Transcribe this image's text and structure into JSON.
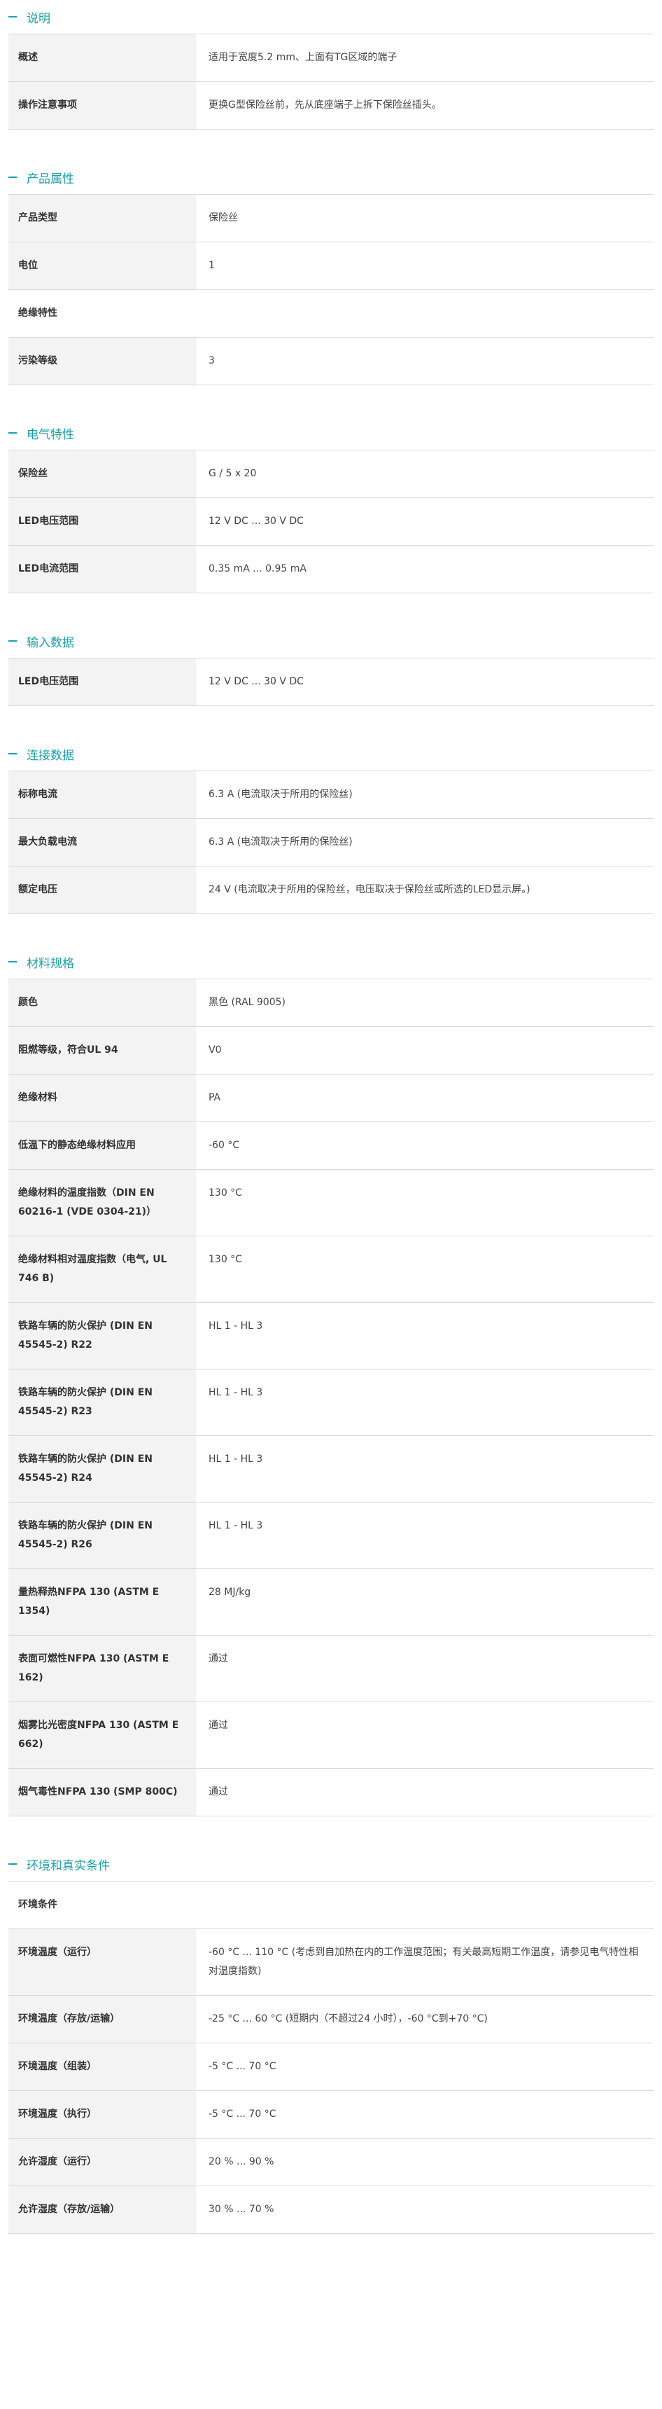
{
  "sections": {
    "s1": {
      "title": "说明",
      "rows": [
        {
          "k": "概述",
          "v": "适用于宽度5.2 mm、上面有TG区域的端子"
        },
        {
          "k": "操作注意事项",
          "v": "更换G型保险丝前，先从底座端子上拆下保险丝插头。"
        }
      ]
    },
    "s2": {
      "title": "产品属性",
      "rows": [
        {
          "k": "产品类型",
          "v": "保险丝"
        },
        {
          "k": "电位",
          "v": "1"
        }
      ],
      "subhead": "绝缘特性",
      "rows2": [
        {
          "k": "污染等级",
          "v": "3"
        }
      ]
    },
    "s3": {
      "title": "电气特性",
      "rows": [
        {
          "k": "保险丝",
          "v": "G / 5 x 20"
        },
        {
          "k": "LED电压范围",
          "v": "12 V DC ... 30 V DC"
        },
        {
          "k": "LED电流范围",
          "v": "0.35 mA ... 0.95 mA"
        }
      ]
    },
    "s4": {
      "title": "输入数据",
      "rows": [
        {
          "k": "LED电压范围",
          "v": "12 V DC ... 30 V DC"
        }
      ]
    },
    "s5": {
      "title": "连接数据",
      "rows": [
        {
          "k": "标称电流",
          "v": "6.3 A (电流取决于所用的保险丝)"
        },
        {
          "k": "最大负载电流",
          "v": "6.3 A (电流取决于所用的保险丝)"
        },
        {
          "k": "额定电压",
          "v": "24 V (电流取决于所用的保险丝，电压取决于保险丝或所选的LED显示屏。)"
        }
      ]
    },
    "s6": {
      "title": "材料规格",
      "rows": [
        {
          "k": "颜色",
          "v": "黑色 (RAL 9005)"
        },
        {
          "k": "阻燃等级，符合UL 94",
          "v": "V0"
        },
        {
          "k": "绝缘材料",
          "v": "PA"
        },
        {
          "k": "低温下的静态绝缘材料应用",
          "v": "-60 °C"
        },
        {
          "k": "绝缘材料的温度指数（DIN EN 60216-1 (VDE 0304-21)）",
          "v": "130 °C"
        },
        {
          "k": "绝缘材料相对温度指数（电气, UL 746 B)",
          "v": "130 °C"
        },
        {
          "k": "铁路车辆的防火保护 (DIN EN 45545-2) R22",
          "v": "HL 1 - HL 3"
        },
        {
          "k": "铁路车辆的防火保护 (DIN EN 45545-2) R23",
          "v": "HL 1 - HL 3"
        },
        {
          "k": "铁路车辆的防火保护 (DIN EN 45545-2) R24",
          "v": "HL 1 - HL 3"
        },
        {
          "k": "铁路车辆的防火保护 (DIN EN 45545-2) R26",
          "v": "HL 1 - HL 3"
        },
        {
          "k": "量热释热NFPA 130 (ASTM E 1354)",
          "v": "28 MJ/kg"
        },
        {
          "k": "表面可燃性NFPA 130 (ASTM E 162)",
          "v": "通过"
        },
        {
          "k": "烟雾比光密度NFPA 130 (ASTM E 662)",
          "v": "通过"
        },
        {
          "k": "烟气毒性NFPA 130 (SMP 800C)",
          "v": "通过"
        }
      ]
    },
    "s7": {
      "title": "环境和真实条件",
      "subhead": "环境条件",
      "rows": [
        {
          "k": "环境温度（运行）",
          "v": "-60 °C ... 110 °C (考虑到自加热在内的工作温度范围；有关最高短期工作温度，请参见电气特性相对温度指数)"
        },
        {
          "k": "环境温度（存放/运输）",
          "v": "-25 °C ... 60 °C (短期内（不超过24 小时），-60 °C到+70 °C)"
        },
        {
          "k": "环境温度（组装）",
          "v": "-5 °C ... 70 °C"
        },
        {
          "k": "环境温度（执行）",
          "v": "-5 °C ... 70 °C"
        },
        {
          "k": "允许湿度（运行）",
          "v": "20 % ... 90 %"
        },
        {
          "k": "允许湿度（存放/运输）",
          "v": "30 % ... 70 %"
        }
      ]
    }
  }
}
